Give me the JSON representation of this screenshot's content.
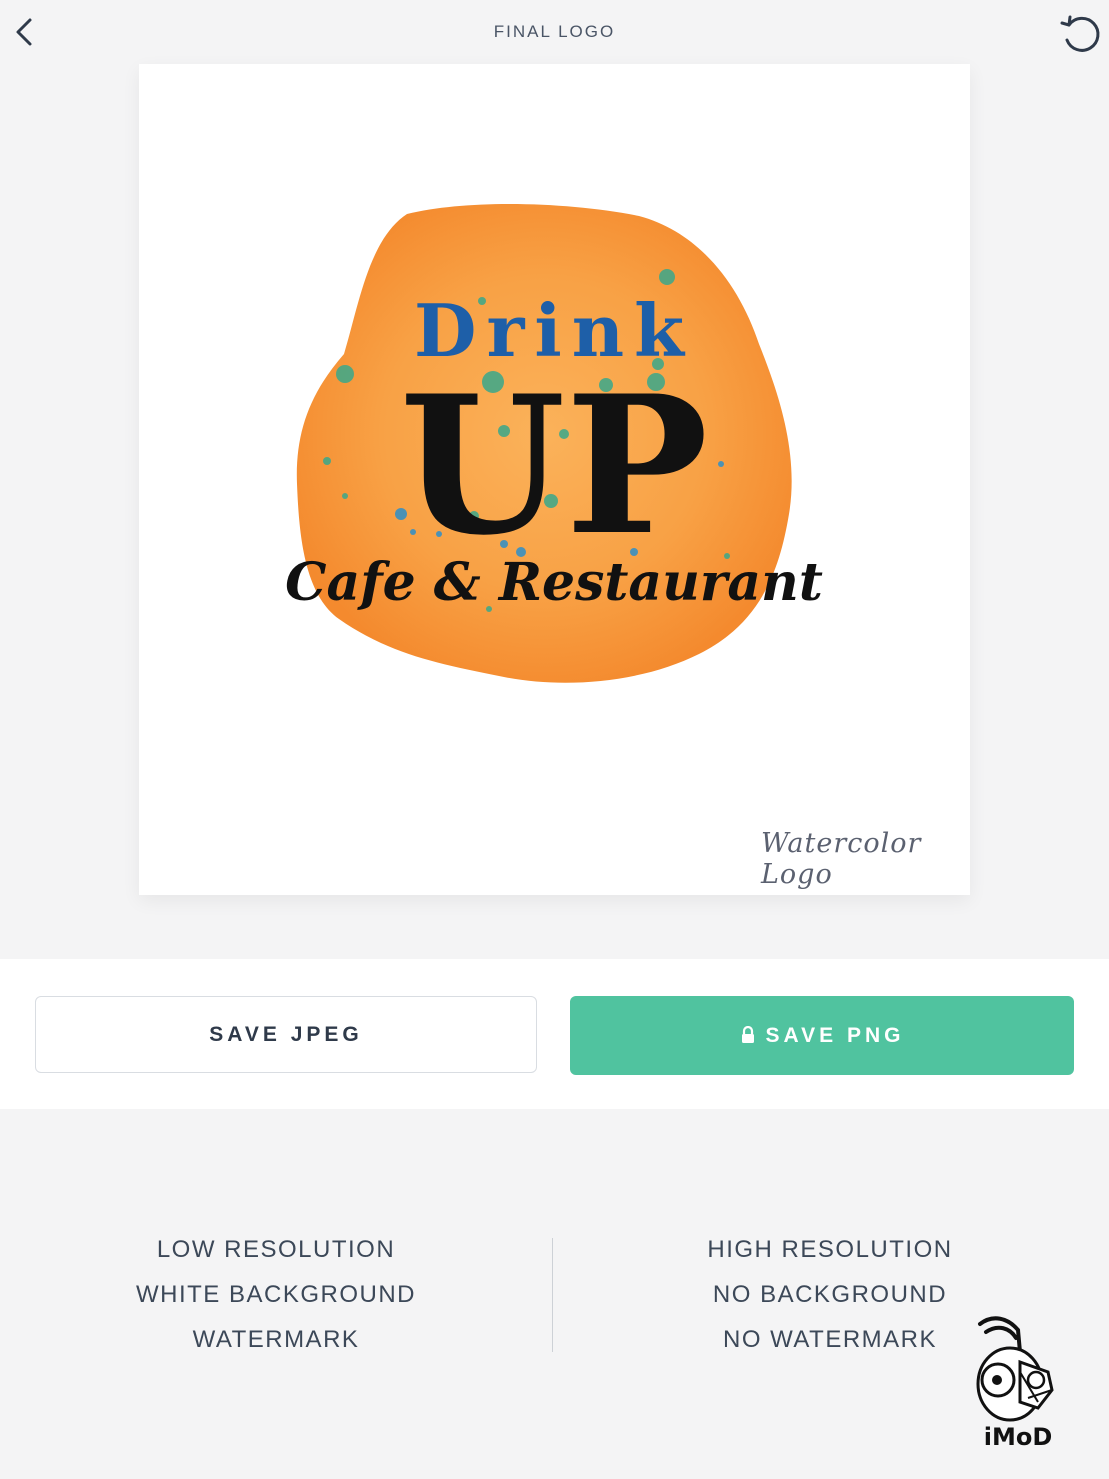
{
  "header": {
    "title": "FINAL LOGO"
  },
  "logo": {
    "line1": "Drink",
    "line2": "UP",
    "line3": "Cafe & Restaurant",
    "watermark": "Watercolor Logo",
    "colors": {
      "blob": "#f7943a",
      "drink": "#1e5fa8",
      "up": "#111111",
      "splatter": "#3aa88b"
    }
  },
  "actions": {
    "save_jpeg": "SAVE JPEG",
    "save_png": "SAVE PNG",
    "png_color": "#50c39f"
  },
  "features": {
    "jpeg": [
      "LOW RESOLUTION",
      "WHITE BACKGROUND",
      "WATERMARK"
    ],
    "png": [
      "HIGH RESOLUTION",
      "NO BACKGROUND",
      "NO WATERMARK"
    ]
  },
  "corner_badge": {
    "text": "iMoD"
  }
}
